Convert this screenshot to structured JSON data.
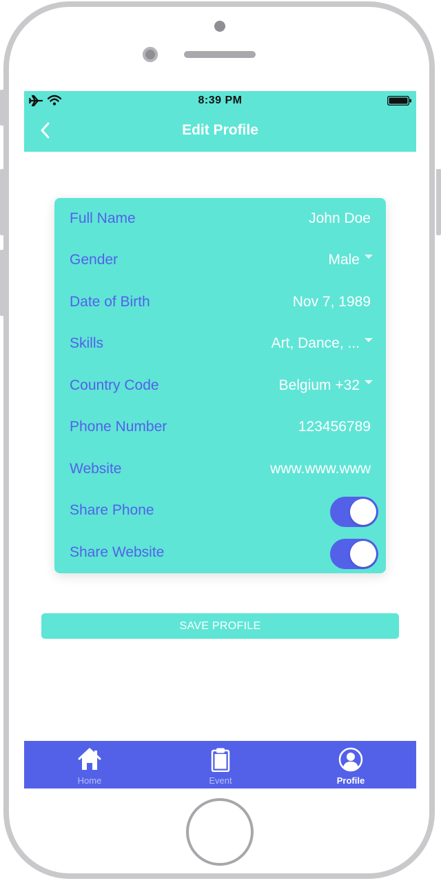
{
  "status_bar": {
    "time": "8:39 PM"
  },
  "nav": {
    "title": "Edit Profile"
  },
  "form": {
    "fields": [
      {
        "label": "Full Name",
        "value": "John Doe"
      },
      {
        "label": "Gender",
        "value": "Male"
      },
      {
        "label": "Date of Birth",
        "value": "Nov 7, 1989"
      },
      {
        "label": "Skills",
        "value": "Art, Dance, ..."
      },
      {
        "label": "Country Code",
        "value": "Belgium +32"
      },
      {
        "label": "Phone Number",
        "value": "123456789"
      },
      {
        "label": "Website",
        "value": "www.www.www"
      }
    ],
    "toggles": [
      {
        "label": "Share Phone",
        "on": true
      },
      {
        "label": "Share Website",
        "on": true
      }
    ]
  },
  "actions": {
    "save_label": "SAVE PROFILE"
  },
  "tab_bar": {
    "tabs": [
      {
        "label": "Home",
        "icon": "home-icon",
        "active": false
      },
      {
        "label": "Event",
        "icon": "clipboard-icon",
        "active": false
      },
      {
        "label": "Profile",
        "icon": "profile-icon",
        "active": true
      }
    ]
  },
  "colors": {
    "teal": "#5ee5d6",
    "indigo": "#5361e8",
    "white": "#ffffff"
  }
}
